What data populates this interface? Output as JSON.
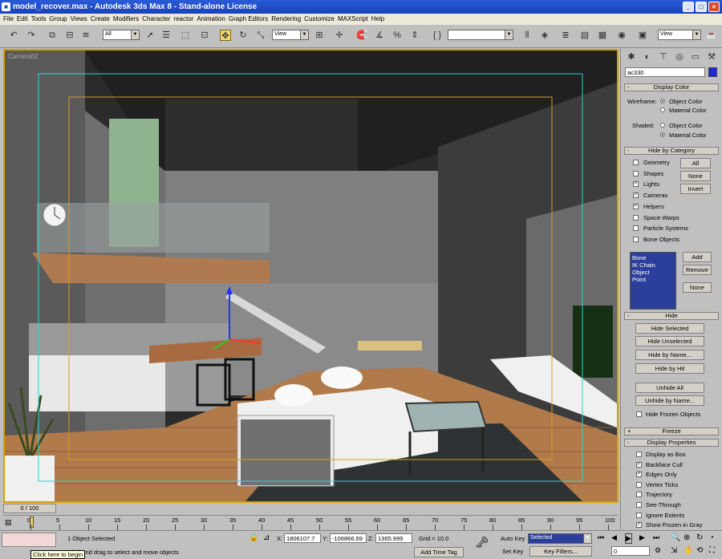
{
  "window": {
    "title": "model_recover.max - Autodesk 3ds Max 8 - Stand-alone License"
  },
  "menu": [
    "File",
    "Edit",
    "Tools",
    "Group",
    "Views",
    "Create",
    "Modifiers",
    "Character",
    "reactor",
    "Animation",
    "Graph Editors",
    "Rendering",
    "Customize",
    "MAXScript",
    "Help"
  ],
  "toolbar": {
    "selection_filter": "All",
    "ref_coord": "View",
    "named_sel": "",
    "view_right": "View"
  },
  "viewport": {
    "label": "Camera02"
  },
  "command_panel": {
    "object_name": "ac330",
    "object_color": "#1a2ad0",
    "display_color": {
      "title": "Display Color",
      "wireframe_label": "Wireframe:",
      "shaded_label": "Shaded:",
      "object_color": "Object Color",
      "material_color": "Material Color"
    },
    "hide_by_category": {
      "title": "Hide by Category",
      "items": [
        {
          "label": "Geometry",
          "checked": false
        },
        {
          "label": "Shapes",
          "checked": false
        },
        {
          "label": "Lights",
          "checked": true
        },
        {
          "label": "Cameras",
          "checked": true
        },
        {
          "label": "Helpers",
          "checked": true
        },
        {
          "label": "Space Warps",
          "checked": false
        },
        {
          "label": "Particle Systems",
          "checked": false
        },
        {
          "label": "Bone Objects",
          "checked": false
        }
      ],
      "all": "All",
      "none": "None",
      "invert": "Invert",
      "list": [
        "Bone",
        "IK Chain Object",
        "Point"
      ],
      "add": "Add",
      "remove": "Remove",
      "none2": "None"
    },
    "hide": {
      "title": "Hide",
      "buttons": [
        "Hide Selected",
        "Hide Unselected",
        "Hide by Name...",
        "Hide by Hit"
      ],
      "unhide_all": "Unhide All",
      "unhide_by_name": "Unhide by Name...",
      "hide_frozen": "Hide Frozen Objects"
    },
    "freeze": {
      "title": "Freeze"
    },
    "display_properties": {
      "title": "Display Properties",
      "items": [
        {
          "label": "Display as Box",
          "checked": false
        },
        {
          "label": "Backface Cull",
          "checked": true
        },
        {
          "label": "Edges Only",
          "checked": true
        },
        {
          "label": "Vertex Ticks",
          "checked": false
        },
        {
          "label": "Trajectory",
          "checked": false
        },
        {
          "label": "See-Through",
          "checked": false
        },
        {
          "label": "Ignore Extents",
          "checked": false
        },
        {
          "label": "Show Frozen in Gray",
          "checked": true
        }
      ]
    }
  },
  "timeline": {
    "slider": "0 / 100",
    "ticks": [
      "0",
      "5",
      "10",
      "15",
      "20",
      "25",
      "30",
      "35",
      "40",
      "45",
      "50",
      "55",
      "60",
      "65",
      "70",
      "75",
      "80",
      "85",
      "90",
      "95",
      "100"
    ]
  },
  "status": {
    "selected": "1 Object Selected",
    "prompt": "Click and drag to select and move objects",
    "tooltip": "Click here to begin",
    "x_label": "X:",
    "x": "1806107.7",
    "y_label": "Y:",
    "y": "-106866.69",
    "z_label": "Z:",
    "z": "1365.999",
    "grid": "Grid = 10.0",
    "add_time_tag": "Add Time Tag",
    "auto_key": "Auto Key",
    "selected_dd": "Selected",
    "set_key": "Set Key",
    "key_filters": "Key Filters...",
    "frame": "0"
  }
}
